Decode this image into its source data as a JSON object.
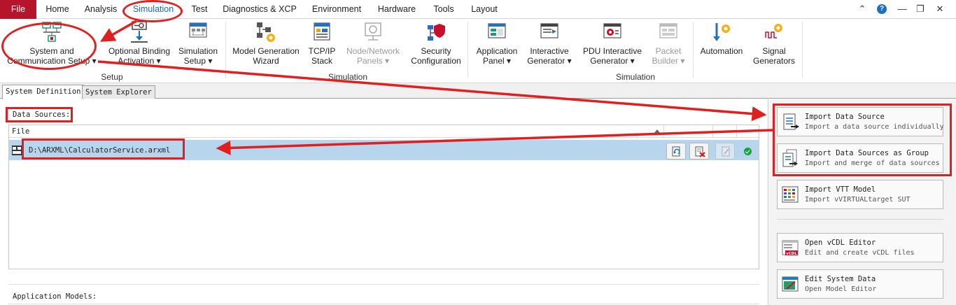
{
  "menu": {
    "tabs": [
      "File",
      "Home",
      "Analysis",
      "Simulation",
      "Test",
      "Diagnostics & XCP",
      "Environment",
      "Hardware",
      "Tools",
      "Layout"
    ],
    "active": "Simulation",
    "help": "?"
  },
  "window": {
    "min": "—",
    "restore": "❐",
    "close": "✕",
    "collapse": "⌃"
  },
  "ribbon": {
    "system_comm": [
      "System and",
      "Communication Setup ▾"
    ],
    "optional_binding": [
      "Optional Binding",
      "Activation ▾"
    ],
    "simulation_setup": [
      "Simulation",
      "Setup ▾"
    ],
    "model_gen": [
      "Model Generation",
      "Wizard"
    ],
    "tcpip": [
      "TCP/IP",
      "Stack"
    ],
    "node_panels": [
      "Node/Network",
      "Panels ▾"
    ],
    "security": [
      "Security",
      "Configuration"
    ],
    "app_panel": [
      "Application",
      "Panel ▾"
    ],
    "interactive_gen": [
      "Interactive",
      "Generator ▾"
    ],
    "pdu_gen": [
      "PDU Interactive",
      "Generator ▾"
    ],
    "packet_builder": [
      "Packet",
      "Builder ▾"
    ],
    "automation": [
      "Automation"
    ],
    "signal_gen": [
      "Signal",
      "Generators"
    ],
    "groups": {
      "setup": "Setup",
      "simulation1": "Simulation",
      "simulation2": "Simulation"
    }
  },
  "doctabs": [
    "System Definition",
    "System Explorer"
  ],
  "main": {
    "data_sources_label": "Data Sources:",
    "file_header": "File",
    "file_path": "D:\\ARXML\\CalculatorService.arxml",
    "app_models_label": "Application Models:"
  },
  "side": {
    "import_ds": {
      "title": "Import Data Source",
      "sub": "Import a data source individually"
    },
    "import_group": {
      "title": "Import Data Sources as Group",
      "sub": "Import and merge of data sources"
    },
    "import_vtt": {
      "title": "Import VTT Model",
      "sub": "Import vVIRTUALtarget SUT"
    },
    "vcdl": {
      "title": "Open vCDL Editor",
      "sub": "Edit and create vCDL files"
    },
    "edit_sys": {
      "title": "Edit System Data",
      "sub": "Open Model Editor"
    }
  },
  "colors": {
    "accent_red": "#e02020",
    "file_tab": "#b5142b",
    "selection": "#b7d6ee",
    "active_tab_text": "#1769b8"
  }
}
